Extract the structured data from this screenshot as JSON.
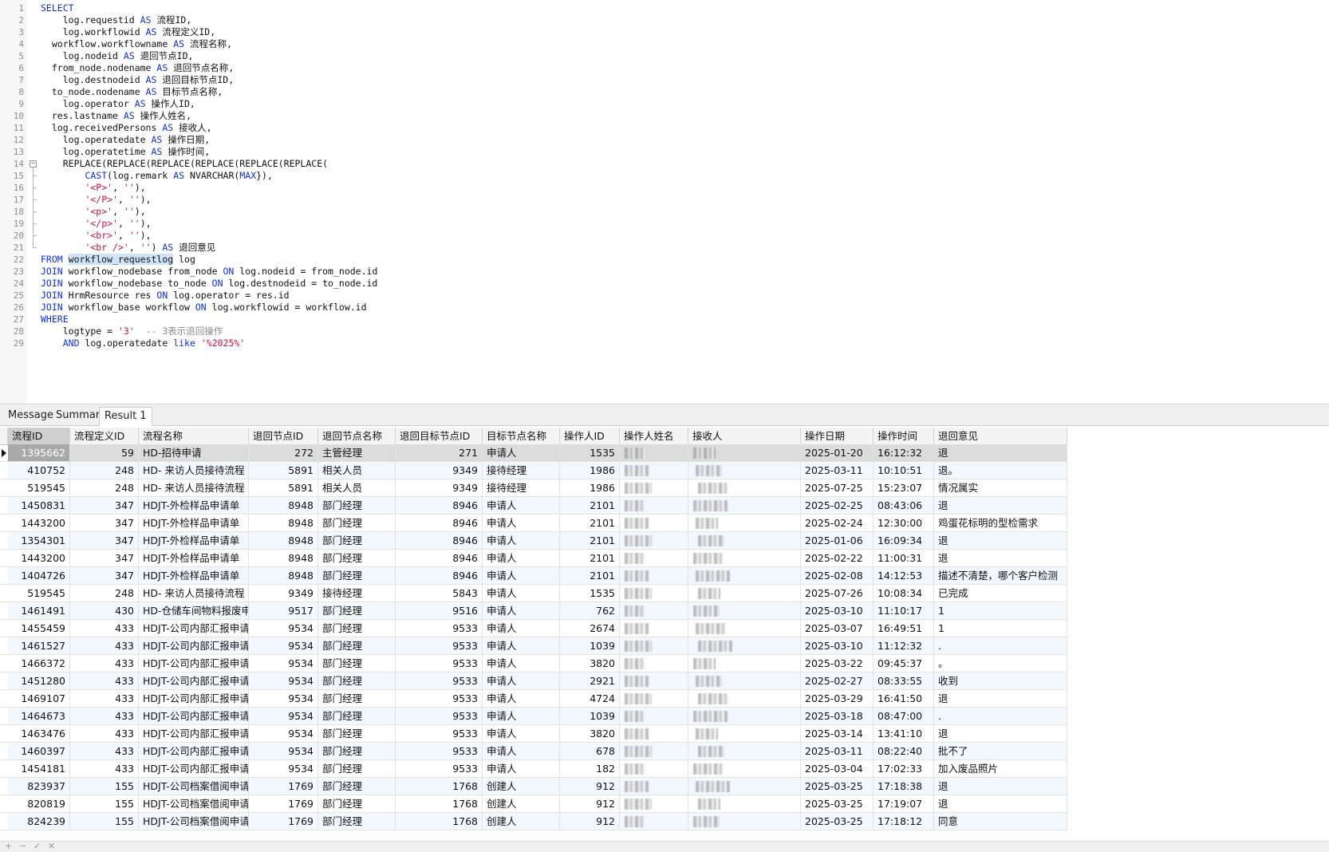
{
  "editor": {
    "lines": [
      {
        "n": "1",
        "indent": 0,
        "segs": [
          [
            "kw",
            "SELECT"
          ]
        ]
      },
      {
        "n": "2",
        "indent": 4,
        "segs": [
          [
            "",
            "log.requestid "
          ],
          [
            "kw",
            "AS"
          ],
          [
            "",
            " 流程ID,"
          ]
        ]
      },
      {
        "n": "3",
        "indent": 4,
        "segs": [
          [
            "",
            "log.workflowid "
          ],
          [
            "kw",
            "AS"
          ],
          [
            "",
            " 流程定义ID,"
          ]
        ]
      },
      {
        "n": "4",
        "indent": 2,
        "segs": [
          [
            "",
            "workflow.workflowname "
          ],
          [
            "kw",
            "AS"
          ],
          [
            "",
            " 流程名称,"
          ]
        ]
      },
      {
        "n": "5",
        "indent": 4,
        "segs": [
          [
            "",
            "log.nodeid "
          ],
          [
            "kw",
            "AS"
          ],
          [
            "",
            " 退回节点ID,"
          ]
        ]
      },
      {
        "n": "6",
        "indent": 2,
        "segs": [
          [
            "",
            "from_node.nodename "
          ],
          [
            "kw",
            "AS"
          ],
          [
            "",
            " 退回节点名称,"
          ]
        ]
      },
      {
        "n": "7",
        "indent": 4,
        "segs": [
          [
            "",
            "log.destnodeid "
          ],
          [
            "kw",
            "AS"
          ],
          [
            "",
            " 退回目标节点ID,"
          ]
        ]
      },
      {
        "n": "8",
        "indent": 2,
        "segs": [
          [
            "",
            "to_node.nodename "
          ],
          [
            "kw",
            "AS"
          ],
          [
            "",
            " 目标节点名称,"
          ]
        ]
      },
      {
        "n": "9",
        "indent": 4,
        "segs": [
          [
            "",
            "log.operator "
          ],
          [
            "kw",
            "AS"
          ],
          [
            "",
            " 操作人ID,"
          ]
        ]
      },
      {
        "n": "10",
        "indent": 2,
        "segs": [
          [
            "",
            "res.lastname "
          ],
          [
            "kw",
            "AS"
          ],
          [
            "",
            " 操作人姓名,"
          ]
        ]
      },
      {
        "n": "11",
        "indent": 2,
        "segs": [
          [
            "",
            "log.receivedPersons "
          ],
          [
            "kw",
            "AS"
          ],
          [
            "",
            " 接收人,"
          ]
        ]
      },
      {
        "n": "12",
        "indent": 4,
        "segs": [
          [
            "",
            "log.operatedate "
          ],
          [
            "kw",
            "AS"
          ],
          [
            "",
            " 操作日期,"
          ]
        ]
      },
      {
        "n": "13",
        "indent": 4,
        "segs": [
          [
            "",
            "log.operatetime "
          ],
          [
            "kw",
            "AS"
          ],
          [
            "",
            " 操作时间,"
          ]
        ]
      },
      {
        "n": "14",
        "indent": 4,
        "segs": [
          [
            "",
            "REPLACE(REPLACE(REPLACE(REPLACE(REPLACE(REPLACE("
          ]
        ]
      },
      {
        "n": "15",
        "indent": 8,
        "segs": [
          [
            "kw",
            "CAST"
          ],
          [
            "",
            "(log.remark "
          ],
          [
            "kw",
            "AS"
          ],
          [
            "",
            " NVARCHAR("
          ],
          [
            "kw",
            "MAX"
          ],
          [
            "",
            "}),"
          ]
        ]
      },
      {
        "n": "16",
        "indent": 8,
        "segs": [
          [
            "str",
            "'<P>'"
          ],
          [
            "",
            ", "
          ],
          [
            "str",
            "''"
          ],
          [
            "",
            "),"
          ]
        ]
      },
      {
        "n": "17",
        "indent": 8,
        "segs": [
          [
            "str",
            "'</P>'"
          ],
          [
            "",
            ", "
          ],
          [
            "str",
            "''"
          ],
          [
            "",
            "),"
          ]
        ]
      },
      {
        "n": "18",
        "indent": 8,
        "segs": [
          [
            "str",
            "'<p>'"
          ],
          [
            "",
            ", "
          ],
          [
            "str",
            "''"
          ],
          [
            "",
            "),"
          ]
        ]
      },
      {
        "n": "19",
        "indent": 8,
        "segs": [
          [
            "str",
            "'</p>'"
          ],
          [
            "",
            ", "
          ],
          [
            "str",
            "''"
          ],
          [
            "",
            "),"
          ]
        ]
      },
      {
        "n": "20",
        "indent": 8,
        "segs": [
          [
            "str",
            "'<br>'"
          ],
          [
            "",
            ", "
          ],
          [
            "str",
            "''"
          ],
          [
            "",
            "),"
          ]
        ]
      },
      {
        "n": "21",
        "indent": 8,
        "segs": [
          [
            "str",
            "'<br />'"
          ],
          [
            "",
            ", "
          ],
          [
            "str",
            "''"
          ],
          [
            "",
            ") "
          ],
          [
            "kw",
            "AS"
          ],
          [
            "",
            " 退回意见"
          ]
        ]
      },
      {
        "n": "22",
        "indent": 0,
        "segs": [
          [
            "kw",
            "FROM"
          ],
          [
            "",
            " "
          ],
          [
            "sel",
            "workflow_requestlog"
          ],
          [
            "",
            " log"
          ]
        ]
      },
      {
        "n": "23",
        "indent": 0,
        "segs": [
          [
            "kw",
            "JOIN"
          ],
          [
            "",
            " workflow_nodebase from_node "
          ],
          [
            "kw",
            "ON"
          ],
          [
            "",
            " log.nodeid = from_node.id"
          ]
        ]
      },
      {
        "n": "24",
        "indent": 0,
        "segs": [
          [
            "kw",
            "JOIN"
          ],
          [
            "",
            " workflow_nodebase to_node "
          ],
          [
            "kw",
            "ON"
          ],
          [
            "",
            " log.destnodeid = to_node.id"
          ]
        ]
      },
      {
        "n": "25",
        "indent": 0,
        "segs": [
          [
            "kw",
            "JOIN"
          ],
          [
            "",
            " HrmResource res "
          ],
          [
            "kw",
            "ON"
          ],
          [
            "",
            " log.operator = res.id"
          ]
        ]
      },
      {
        "n": "26",
        "indent": 0,
        "segs": [
          [
            "kw",
            "JOIN"
          ],
          [
            "",
            " workflow_base workflow "
          ],
          [
            "kw",
            "ON"
          ],
          [
            "",
            " log.workflowid = workflow.id"
          ]
        ]
      },
      {
        "n": "27",
        "indent": 0,
        "segs": [
          [
            "kw",
            "WHERE"
          ]
        ]
      },
      {
        "n": "28",
        "indent": 4,
        "segs": [
          [
            "",
            "logtype = "
          ],
          [
            "str",
            "'3'"
          ],
          [
            "",
            "  "
          ],
          [
            "cm",
            "-- 3表示退回操作"
          ]
        ]
      },
      {
        "n": "29",
        "indent": 4,
        "segs": [
          [
            "kw",
            "AND"
          ],
          [
            "",
            " log.operatedate "
          ],
          [
            "kw",
            "like"
          ],
          [
            "",
            " "
          ],
          [
            "str",
            "'%2025%'"
          ]
        ]
      }
    ]
  },
  "tabs": [
    {
      "label": "Message",
      "active": false
    },
    {
      "label": "Summary",
      "active": false
    },
    {
      "label": "Result 1",
      "active": true
    }
  ],
  "grid": {
    "columns": [
      "流程ID",
      "流程定义ID",
      "流程名称",
      "退回节点ID",
      "退回节点名称",
      "退回目标节点ID",
      "目标节点名称",
      "操作人ID",
      "操作人姓名",
      "接收人",
      "操作日期",
      "操作时间",
      "退回意见"
    ],
    "rows": [
      [
        "1395662",
        "59",
        "HD-招待申请",
        "272",
        "主管经理",
        "271",
        "申请人",
        "1535",
        "",
        "",
        "2025-01-20",
        "16:12:32",
        "退"
      ],
      [
        "410752",
        "248",
        "HD- 来访人员接待流程",
        "5891",
        "相关人员",
        "9349",
        "接待经理",
        "1986",
        "",
        "",
        "2025-03-11",
        "10:10:51",
        "退。"
      ],
      [
        "519545",
        "248",
        "HD- 来访人员接待流程",
        "5891",
        "相关人员",
        "9349",
        "接待经理",
        "1986",
        "",
        "",
        "2025-07-25",
        "15:23:07",
        "情况属实"
      ],
      [
        "1450831",
        "347",
        "HDJT-外检样品申请单",
        "8948",
        "部门经理",
        "8946",
        "申请人",
        "2101",
        "",
        "",
        "2025-02-25",
        "08:43:06",
        "退"
      ],
      [
        "1443200",
        "347",
        "HDJT-外检样品申请单",
        "8948",
        "部门经理",
        "8946",
        "申请人",
        "2101",
        "",
        "",
        "2025-02-24",
        "12:30:00",
        "鸡蛋花标明的型检需求"
      ],
      [
        "1354301",
        "347",
        "HDJT-外检样品申请单",
        "8948",
        "部门经理",
        "8946",
        "申请人",
        "2101",
        "",
        "",
        "2025-01-06",
        "16:09:34",
        "退"
      ],
      [
        "1443200",
        "347",
        "HDJT-外检样品申请单",
        "8948",
        "部门经理",
        "8946",
        "申请人",
        "2101",
        "",
        "",
        "2025-02-22",
        "11:00:31",
        "退"
      ],
      [
        "1404726",
        "347",
        "HDJT-外检样品申请单",
        "8948",
        "部门经理",
        "8946",
        "申请人",
        "2101",
        "",
        "",
        "2025-02-08",
        "14:12:53",
        "描述不清楚，哪个客户检测"
      ],
      [
        "519545",
        "248",
        "HD- 来访人员接待流程",
        "9349",
        "接待经理",
        "5843",
        "申请人",
        "1535",
        "",
        "",
        "2025-07-26",
        "10:08:34",
        "已完成"
      ],
      [
        "1461491",
        "430",
        "HD-仓储车间物料报废申请",
        "9517",
        "部门经理",
        "9516",
        "申请人",
        "762",
        "",
        "",
        "2025-03-10",
        "11:10:17",
        "1"
      ],
      [
        "1455459",
        "433",
        "HDJT-公司内部汇报申请流",
        "9534",
        "部门经理",
        "9533",
        "申请人",
        "2674",
        "",
        "",
        "2025-03-07",
        "16:49:51",
        "1"
      ],
      [
        "1461527",
        "433",
        "HDJT-公司内部汇报申请流",
        "9534",
        "部门经理",
        "9533",
        "申请人",
        "1039",
        "",
        "",
        "2025-03-10",
        "11:12:32",
        "."
      ],
      [
        "1466372",
        "433",
        "HDJT-公司内部汇报申请流",
        "9534",
        "部门经理",
        "9533",
        "申请人",
        "3820",
        "",
        "",
        "2025-03-22",
        "09:45:37",
        "。"
      ],
      [
        "1451280",
        "433",
        "HDJT-公司内部汇报申请流",
        "9534",
        "部门经理",
        "9533",
        "申请人",
        "2921",
        "",
        "",
        "2025-02-27",
        "08:33:55",
        "收到"
      ],
      [
        "1469107",
        "433",
        "HDJT-公司内部汇报申请流",
        "9534",
        "部门经理",
        "9533",
        "申请人",
        "4724",
        "",
        "",
        "2025-03-29",
        "16:41:50",
        "退"
      ],
      [
        "1464673",
        "433",
        "HDJT-公司内部汇报申请流",
        "9534",
        "部门经理",
        "9533",
        "申请人",
        "1039",
        "",
        "",
        "2025-03-18",
        "08:47:00",
        "."
      ],
      [
        "1463476",
        "433",
        "HDJT-公司内部汇报申请流",
        "9534",
        "部门经理",
        "9533",
        "申请人",
        "3820",
        "",
        "",
        "2025-03-14",
        "13:41:10",
        "退"
      ],
      [
        "1460397",
        "433",
        "HDJT-公司内部汇报申请流",
        "9534",
        "部门经理",
        "9533",
        "申请人",
        "678",
        "",
        "",
        "2025-03-11",
        "08:22:40",
        "批不了"
      ],
      [
        "1454181",
        "433",
        "HDJT-公司内部汇报申请流",
        "9534",
        "部门经理",
        "9533",
        "申请人",
        "182",
        "",
        "",
        "2025-03-04",
        "17:02:33",
        "加入废品照片"
      ],
      [
        "823937",
        "155",
        "HDJT-公司档案借阅申请",
        "1769",
        "部门经理",
        "1768",
        "创建人",
        "912",
        "",
        "",
        "2025-03-25",
        "17:18:38",
        "退"
      ],
      [
        "820819",
        "155",
        "HDJT-公司档案借阅申请",
        "1769",
        "部门经理",
        "1768",
        "创建人",
        "912",
        "",
        "",
        "2025-03-25",
        "17:19:07",
        "退"
      ],
      [
        "824239",
        "155",
        "HDJT-公司档案借阅申请",
        "1769",
        "部门经理",
        "1768",
        "创建人",
        "912",
        "",
        "",
        "2025-03-25",
        "17:18:12",
        "同意"
      ]
    ]
  },
  "statusbar": {
    "icons": [
      "plus-icon",
      "minus-icon",
      "check-icon",
      "close-icon"
    ],
    "glyphs": [
      "+",
      "−",
      "✓",
      "✕"
    ]
  }
}
